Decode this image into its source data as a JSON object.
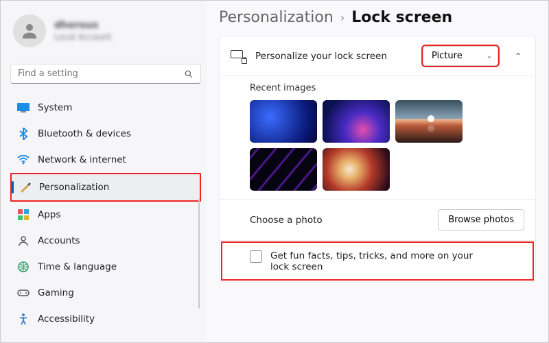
{
  "profile": {
    "name": "dherous",
    "sub": "Local Account"
  },
  "search": {
    "placeholder": "Find a setting"
  },
  "sidebar": {
    "items": [
      {
        "label": "System"
      },
      {
        "label": "Bluetooth & devices"
      },
      {
        "label": "Network & internet"
      },
      {
        "label": "Personalization"
      },
      {
        "label": "Apps"
      },
      {
        "label": "Accounts"
      },
      {
        "label": "Time & language"
      },
      {
        "label": "Gaming"
      },
      {
        "label": "Accessibility"
      }
    ]
  },
  "breadcrumb": {
    "parent": "Personalization",
    "current": "Lock screen"
  },
  "lockCard": {
    "title": "Personalize your lock screen",
    "dropdown": "Picture",
    "recentHead": "Recent images",
    "choose": "Choose a photo",
    "browse": "Browse photos",
    "checkbox": "Get fun facts, tips, tricks, and more on your lock screen"
  }
}
